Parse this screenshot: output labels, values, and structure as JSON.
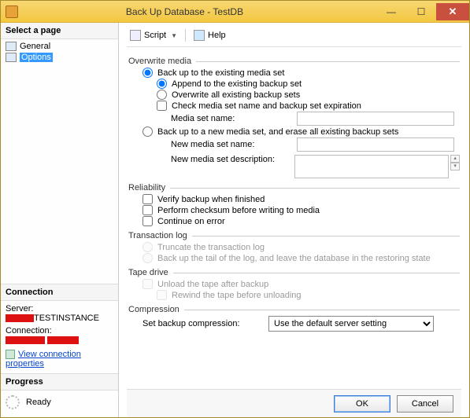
{
  "window": {
    "title": "Back Up Database - TestDB"
  },
  "left": {
    "select_page": "Select a page",
    "pages": {
      "general": "General",
      "options": "Options"
    },
    "connection_h": "Connection",
    "server_lbl": "Server:",
    "server_val": "TESTINSTANCE",
    "connection_lbl": "Connection:",
    "view_props": "View connection properties",
    "progress_h": "Progress",
    "progress_val": "Ready"
  },
  "toolbar": {
    "script": "Script",
    "help": "Help"
  },
  "overwrite": {
    "header": "Overwrite media",
    "back_existing": "Back up to the existing media set",
    "append": "Append to the existing backup set",
    "overwrite_all": "Overwrite all existing backup sets",
    "check_media": "Check media set name and backup set expiration",
    "media_name_lbl": "Media set name:",
    "back_new": "Back up to a new media set, and erase all existing backup sets",
    "new_name_lbl": "New media set name:",
    "new_desc_lbl": "New media set description:"
  },
  "reliability": {
    "header": "Reliability",
    "verify": "Verify backup when finished",
    "checksum": "Perform checksum before writing to media",
    "continue": "Continue on error"
  },
  "tlog": {
    "header": "Transaction log",
    "truncate": "Truncate the transaction log",
    "tail": "Back up the tail of the log, and leave the database in the restoring state"
  },
  "tape": {
    "header": "Tape drive",
    "unload": "Unload the tape after backup",
    "rewind": "Rewind the tape before unloading"
  },
  "compression": {
    "header": "Compression",
    "lbl": "Set backup compression:",
    "value": "Use the default server setting"
  },
  "footer": {
    "ok": "OK",
    "cancel": "Cancel"
  }
}
